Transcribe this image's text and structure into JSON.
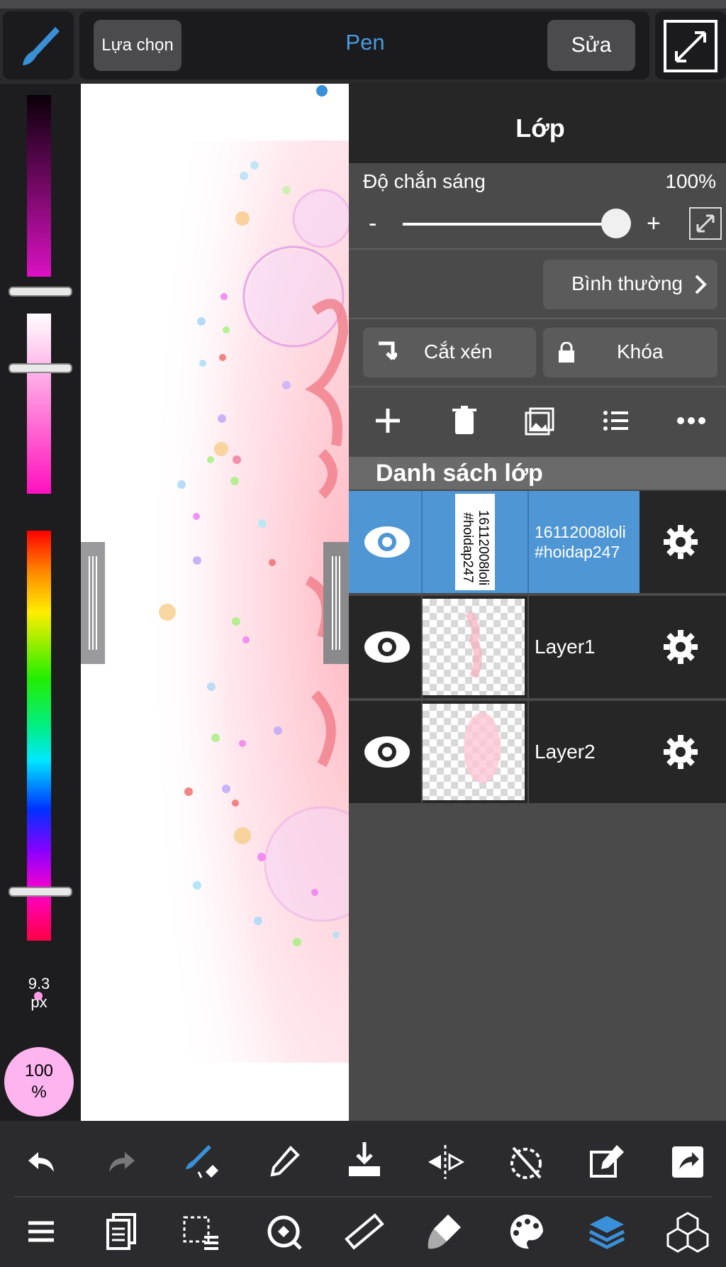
{
  "top_bar": {
    "select_label": "Lựa chọn",
    "tool_title": "Pen",
    "edit_label": "Sửa"
  },
  "color_panel": {
    "brush_size": "9.3",
    "brush_unit": "px",
    "opacity_value": "100",
    "opacity_unit": "%"
  },
  "layer_panel": {
    "title": "Lớp",
    "opacity_label": "Độ chắn sáng",
    "opacity_value": "100%",
    "opacity_level": 1.0,
    "minus": "-",
    "plus": "+",
    "blend_mode": "Bình thường",
    "clip_label": "Cắt xén",
    "lock_label": "Khóa",
    "list_title": "Danh sách lớp",
    "layers": [
      {
        "name_line1": "16112008loli",
        "name_line2": "#hoidap247",
        "selected": true
      },
      {
        "name": "Layer1",
        "selected": false
      },
      {
        "name": "Layer2",
        "selected": false
      }
    ]
  },
  "colors": {
    "accent": "#4a9be0",
    "selected_row": "#4f96d4",
    "panel_bg": "#4a4a4a"
  }
}
